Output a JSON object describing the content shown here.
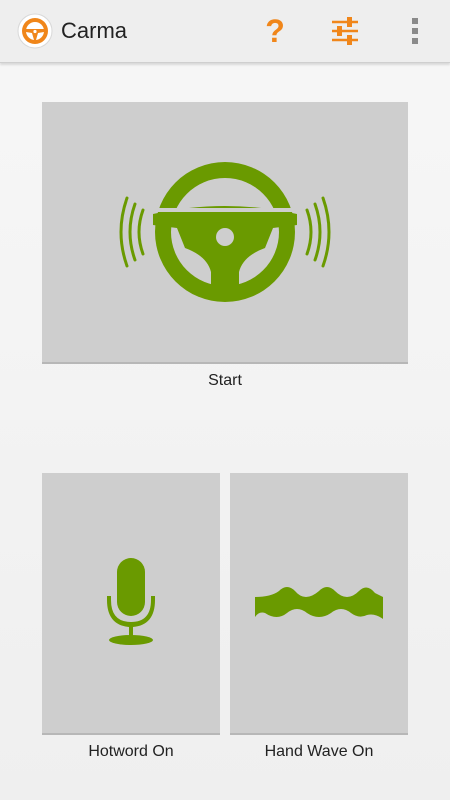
{
  "action_bar": {
    "title": "Carma",
    "help_label": "?"
  },
  "tiles": {
    "start_label": "Start",
    "hotword_label": "Hotword On",
    "hand_wave_label": "Hand Wave On"
  },
  "colors": {
    "accent_green": "#6a9a00",
    "accent_orange": "#f0861a",
    "tile_bg": "#cecece"
  }
}
